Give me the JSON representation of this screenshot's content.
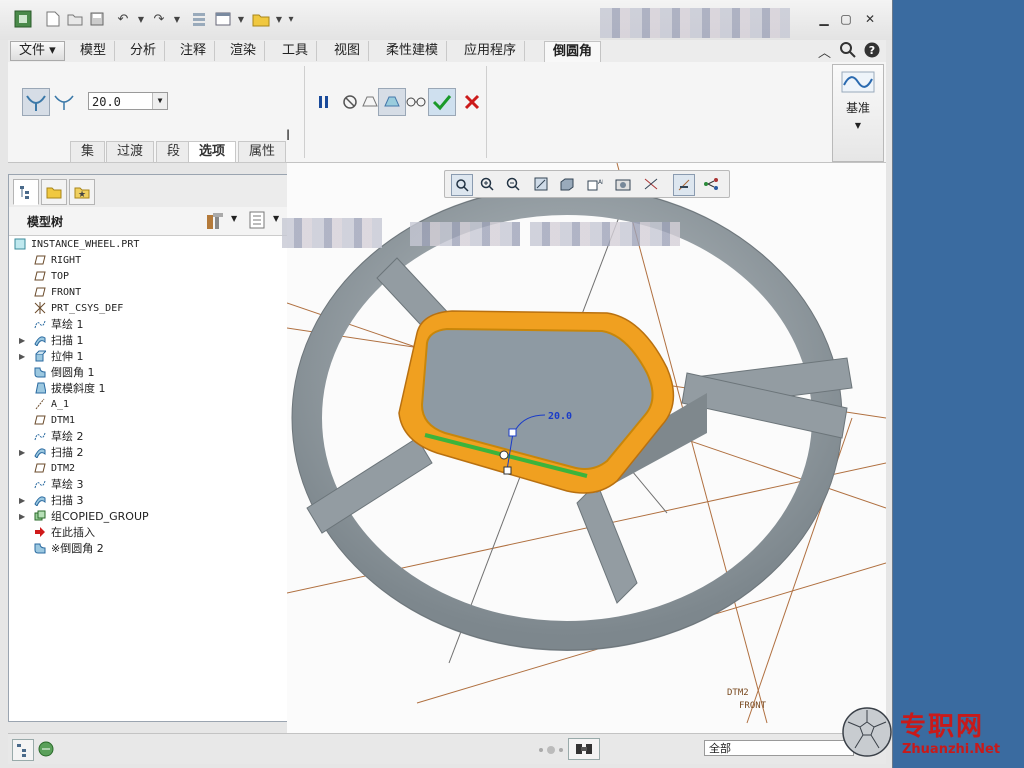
{
  "ribbon_tabs": {
    "file": "文件",
    "items": [
      "模型",
      "分析",
      "注释",
      "渲染",
      "工具",
      "视图",
      "柔性建模",
      "应用程序"
    ],
    "active": "倒圆角"
  },
  "ribbon": {
    "radius_value": "20.0",
    "subtabs": [
      "集",
      "过渡",
      "段",
      "选项",
      "属性"
    ],
    "datum_label": "基准"
  },
  "model_tree": {
    "title": "模型树",
    "root": "INSTANCE_WHEEL.PRT",
    "items": [
      {
        "label": "RIGHT",
        "icon": "datum-plane-icon",
        "expandable": false
      },
      {
        "label": "TOP",
        "icon": "datum-plane-icon",
        "expandable": false
      },
      {
        "label": "FRONT",
        "icon": "datum-plane-icon",
        "expandable": false
      },
      {
        "label": "PRT_CSYS_DEF",
        "icon": "csys-icon",
        "expandable": false
      },
      {
        "label": "草绘 1",
        "icon": "sketch-icon",
        "expandable": false
      },
      {
        "label": "扫描 1",
        "icon": "sweep-icon",
        "expandable": true
      },
      {
        "label": "拉伸 1",
        "icon": "extrude-icon",
        "expandable": true
      },
      {
        "label": "倒圆角 1",
        "icon": "round-icon",
        "expandable": false
      },
      {
        "label": "拔模斜度 1",
        "icon": "draft-icon",
        "expandable": false
      },
      {
        "label": "A_1",
        "icon": "axis-icon",
        "expandable": false
      },
      {
        "label": "DTM1",
        "icon": "datum-plane-icon",
        "expandable": false
      },
      {
        "label": "草绘 2",
        "icon": "sketch-icon",
        "expandable": false
      },
      {
        "label": "扫描 2",
        "icon": "sweep-icon",
        "expandable": true
      },
      {
        "label": "DTM2",
        "icon": "datum-plane-icon",
        "expandable": false
      },
      {
        "label": "草绘 3",
        "icon": "sketch-icon",
        "expandable": false
      },
      {
        "label": "扫描 3",
        "icon": "sweep-icon",
        "expandable": true
      },
      {
        "label": "组COPIED_GROUP",
        "icon": "group-icon",
        "expandable": true
      },
      {
        "label": "在此插入",
        "icon": "insert-arrow-icon",
        "expandable": false
      },
      {
        "label": "※倒圆角 2",
        "icon": "round-icon",
        "expandable": false
      }
    ]
  },
  "viewport": {
    "dimension_value": "20.0",
    "datum_labels": [
      "DTM2",
      "FRONT"
    ]
  },
  "status": {
    "filter_value": "全部"
  },
  "watermark": {
    "text_cn": "专职网",
    "text_en": "Zhuanzhi.Net"
  },
  "colors": {
    "accent_orange": "#f0a020",
    "edge_green": "#3cb43c",
    "wheel_gray": "#9aa3a8",
    "dimension_blue": "#1a3cc8",
    "desktop_blue": "#3a6ba0"
  }
}
